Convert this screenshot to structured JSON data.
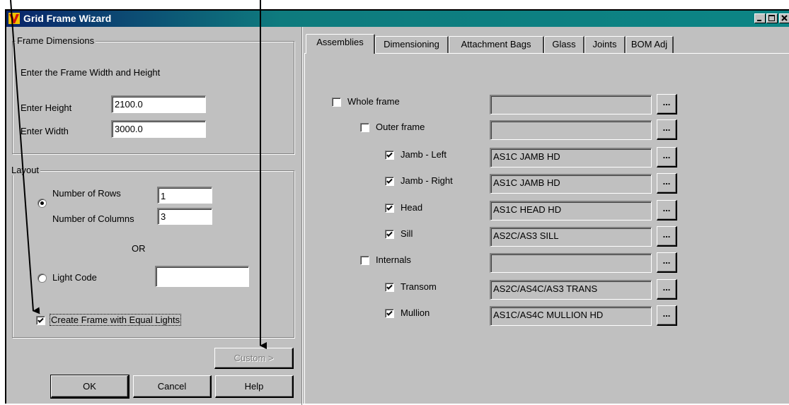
{
  "window": {
    "title": "Grid Frame Wizard"
  },
  "frame_dimensions": {
    "legend": "Frame Dimensions",
    "instruction": "Enter the Frame Width and Height",
    "height_label": "Enter Height",
    "height_value": "2100.0",
    "width_label": "Enter Width",
    "width_value": "3000.0"
  },
  "layout": {
    "legend": "Layout",
    "rows_label": "Number of Rows",
    "rows_value": "1",
    "columns_label": "Number of Columns",
    "columns_value": "3",
    "or_label": "OR",
    "light_code_label": "Light Code",
    "light_code_value": "",
    "equal_lights_label": "Create Frame with Equal Lights",
    "equal_lights_checked": true,
    "rows_radio_selected": true
  },
  "buttons": {
    "custom": "Custom >",
    "ok": "OK",
    "cancel": "Cancel",
    "help": "Help"
  },
  "tabs": [
    "Assemblies",
    "Dimensioning",
    "Attachment Bags",
    "Glass",
    "Joints",
    "BOM Adj"
  ],
  "active_tab": "Assemblies",
  "assemblies": [
    {
      "label": "Whole frame",
      "checked": false,
      "value": ""
    },
    {
      "label": "Outer frame",
      "checked": false,
      "value": ""
    },
    {
      "label": "Jamb - Left",
      "checked": true,
      "value": "AS1C JAMB HD"
    },
    {
      "label": "Jamb - Right",
      "checked": true,
      "value": "AS1C JAMB HD"
    },
    {
      "label": "Head",
      "checked": true,
      "value": "AS1C HEAD HD"
    },
    {
      "label": "Sill",
      "checked": true,
      "value": "AS2C/AS3 SILL"
    },
    {
      "label": "Internals",
      "checked": false,
      "value": ""
    },
    {
      "label": "Transom",
      "checked": true,
      "value": "AS2C/AS4C/AS3 TRANS"
    },
    {
      "label": "Mullion",
      "checked": true,
      "value": "AS1C/AS4C MULLION HD"
    }
  ],
  "browse_label": "...",
  "colors": {
    "titlebar_start": "#0a246a",
    "titlebar_end": "#0c8585",
    "face": "#c0c0c0"
  }
}
